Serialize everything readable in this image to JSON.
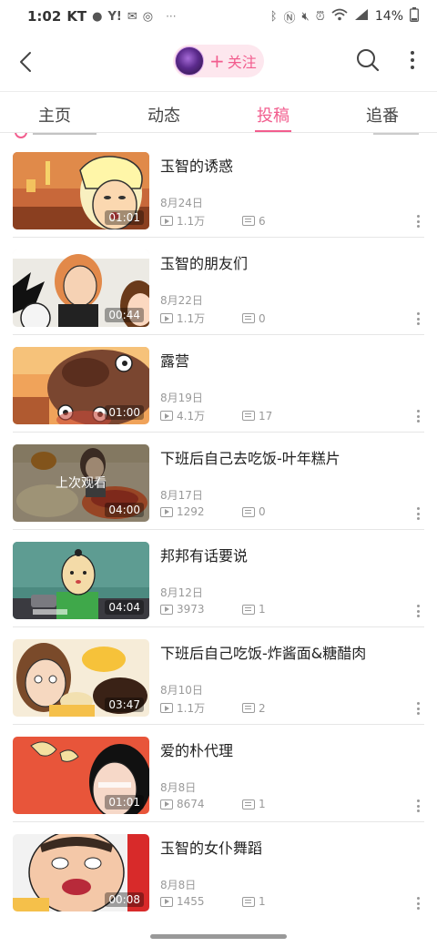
{
  "status_bar": {
    "time": "1:02",
    "carrier": "KT",
    "battery": "14%",
    "icons_left": [
      "chat-icon",
      "yahoo-icon",
      "mail-icon",
      "shazam-icon",
      "more-dots"
    ],
    "icons_right": [
      "bluetooth-icon",
      "nfc-icon",
      "mute-icon",
      "alarm-icon",
      "wifi-icon",
      "signal-icon",
      "battery-icon"
    ]
  },
  "header": {
    "follow_plus": "+",
    "follow_label": "关注"
  },
  "tabs": [
    {
      "label": "主页",
      "active": false
    },
    {
      "label": "动态",
      "active": false
    },
    {
      "label": "投稿",
      "active": true
    },
    {
      "label": "追番",
      "active": false
    }
  ],
  "videos": [
    {
      "title": "玉智的诱惑",
      "date": "8月24日",
      "plays": "1.1万",
      "comments": "6",
      "duration": "01:01",
      "watched": null
    },
    {
      "title": "玉智的朋友们",
      "date": "8月22日",
      "plays": "1.1万",
      "comments": "0",
      "duration": "00:44",
      "watched": null
    },
    {
      "title": "露营",
      "date": "8月19日",
      "plays": "4.1万",
      "comments": "17",
      "duration": "01:00",
      "watched": null
    },
    {
      "title": "下班后自己去吃饭-叶年糕片",
      "date": "8月17日",
      "plays": "1292",
      "comments": "0",
      "duration": "04:00",
      "watched": "上次观看"
    },
    {
      "title": "邦邦有话要说",
      "date": "8月12日",
      "plays": "3973",
      "comments": "1",
      "duration": "04:04",
      "watched": null
    },
    {
      "title": "下班后自己吃饭-炸酱面&糖醋肉",
      "date": "8月10日",
      "plays": "1.1万",
      "comments": "2",
      "duration": "03:47",
      "watched": null
    },
    {
      "title": "爱的朴代理",
      "date": "8月8日",
      "plays": "8674",
      "comments": "1",
      "duration": "01:01",
      "watched": null
    },
    {
      "title": "玉智的女仆舞蹈",
      "date": "8月8日",
      "plays": "1455",
      "comments": "1",
      "duration": "00:08",
      "watched": null
    }
  ],
  "colors": {
    "accent": "#f25d8e",
    "pill_bg": "#fde7ee",
    "text_secondary": "#999999"
  }
}
